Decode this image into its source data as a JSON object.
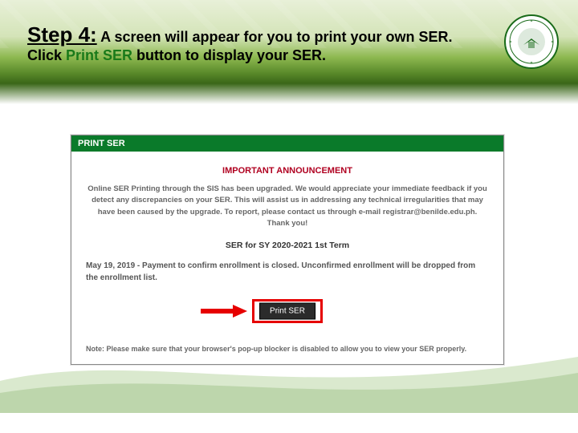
{
  "header": {
    "step_label": "Step 4:",
    "text_before": " A screen will appear for you to print your own SER. Click ",
    "highlight": "Print SER",
    "text_after": " button to display your SER."
  },
  "logo": {
    "name": "college-seal"
  },
  "screenshot": {
    "header": "PRINT SER",
    "announcement_title": "IMPORTANT ANNOUNCEMENT",
    "announcement_body": "Online SER Printing through the SIS has been upgraded. We would appreciate your immediate feedback if you detect any discrepancies on your SER. This will assist us in addressing any technical irregularities that may have been caused by the upgrade. To report, please contact us through e-mail registrar@benilde.edu.ph. Thank you!",
    "ser_for": "SER for SY 2020-2021 1st Term",
    "payment_notice": "May 19, 2019 - Payment to confirm enrollment is closed. Unconfirmed enrollment will be dropped from the enrollment list.",
    "button_label": "Print SER",
    "note": "Note: Please make sure that your browser's pop-up blocker is disabled to allow you to view your SER properly."
  },
  "colors": {
    "accent_green": "#0a7a2a",
    "alert_red": "#e60000",
    "announcement_red": "#b00020"
  }
}
